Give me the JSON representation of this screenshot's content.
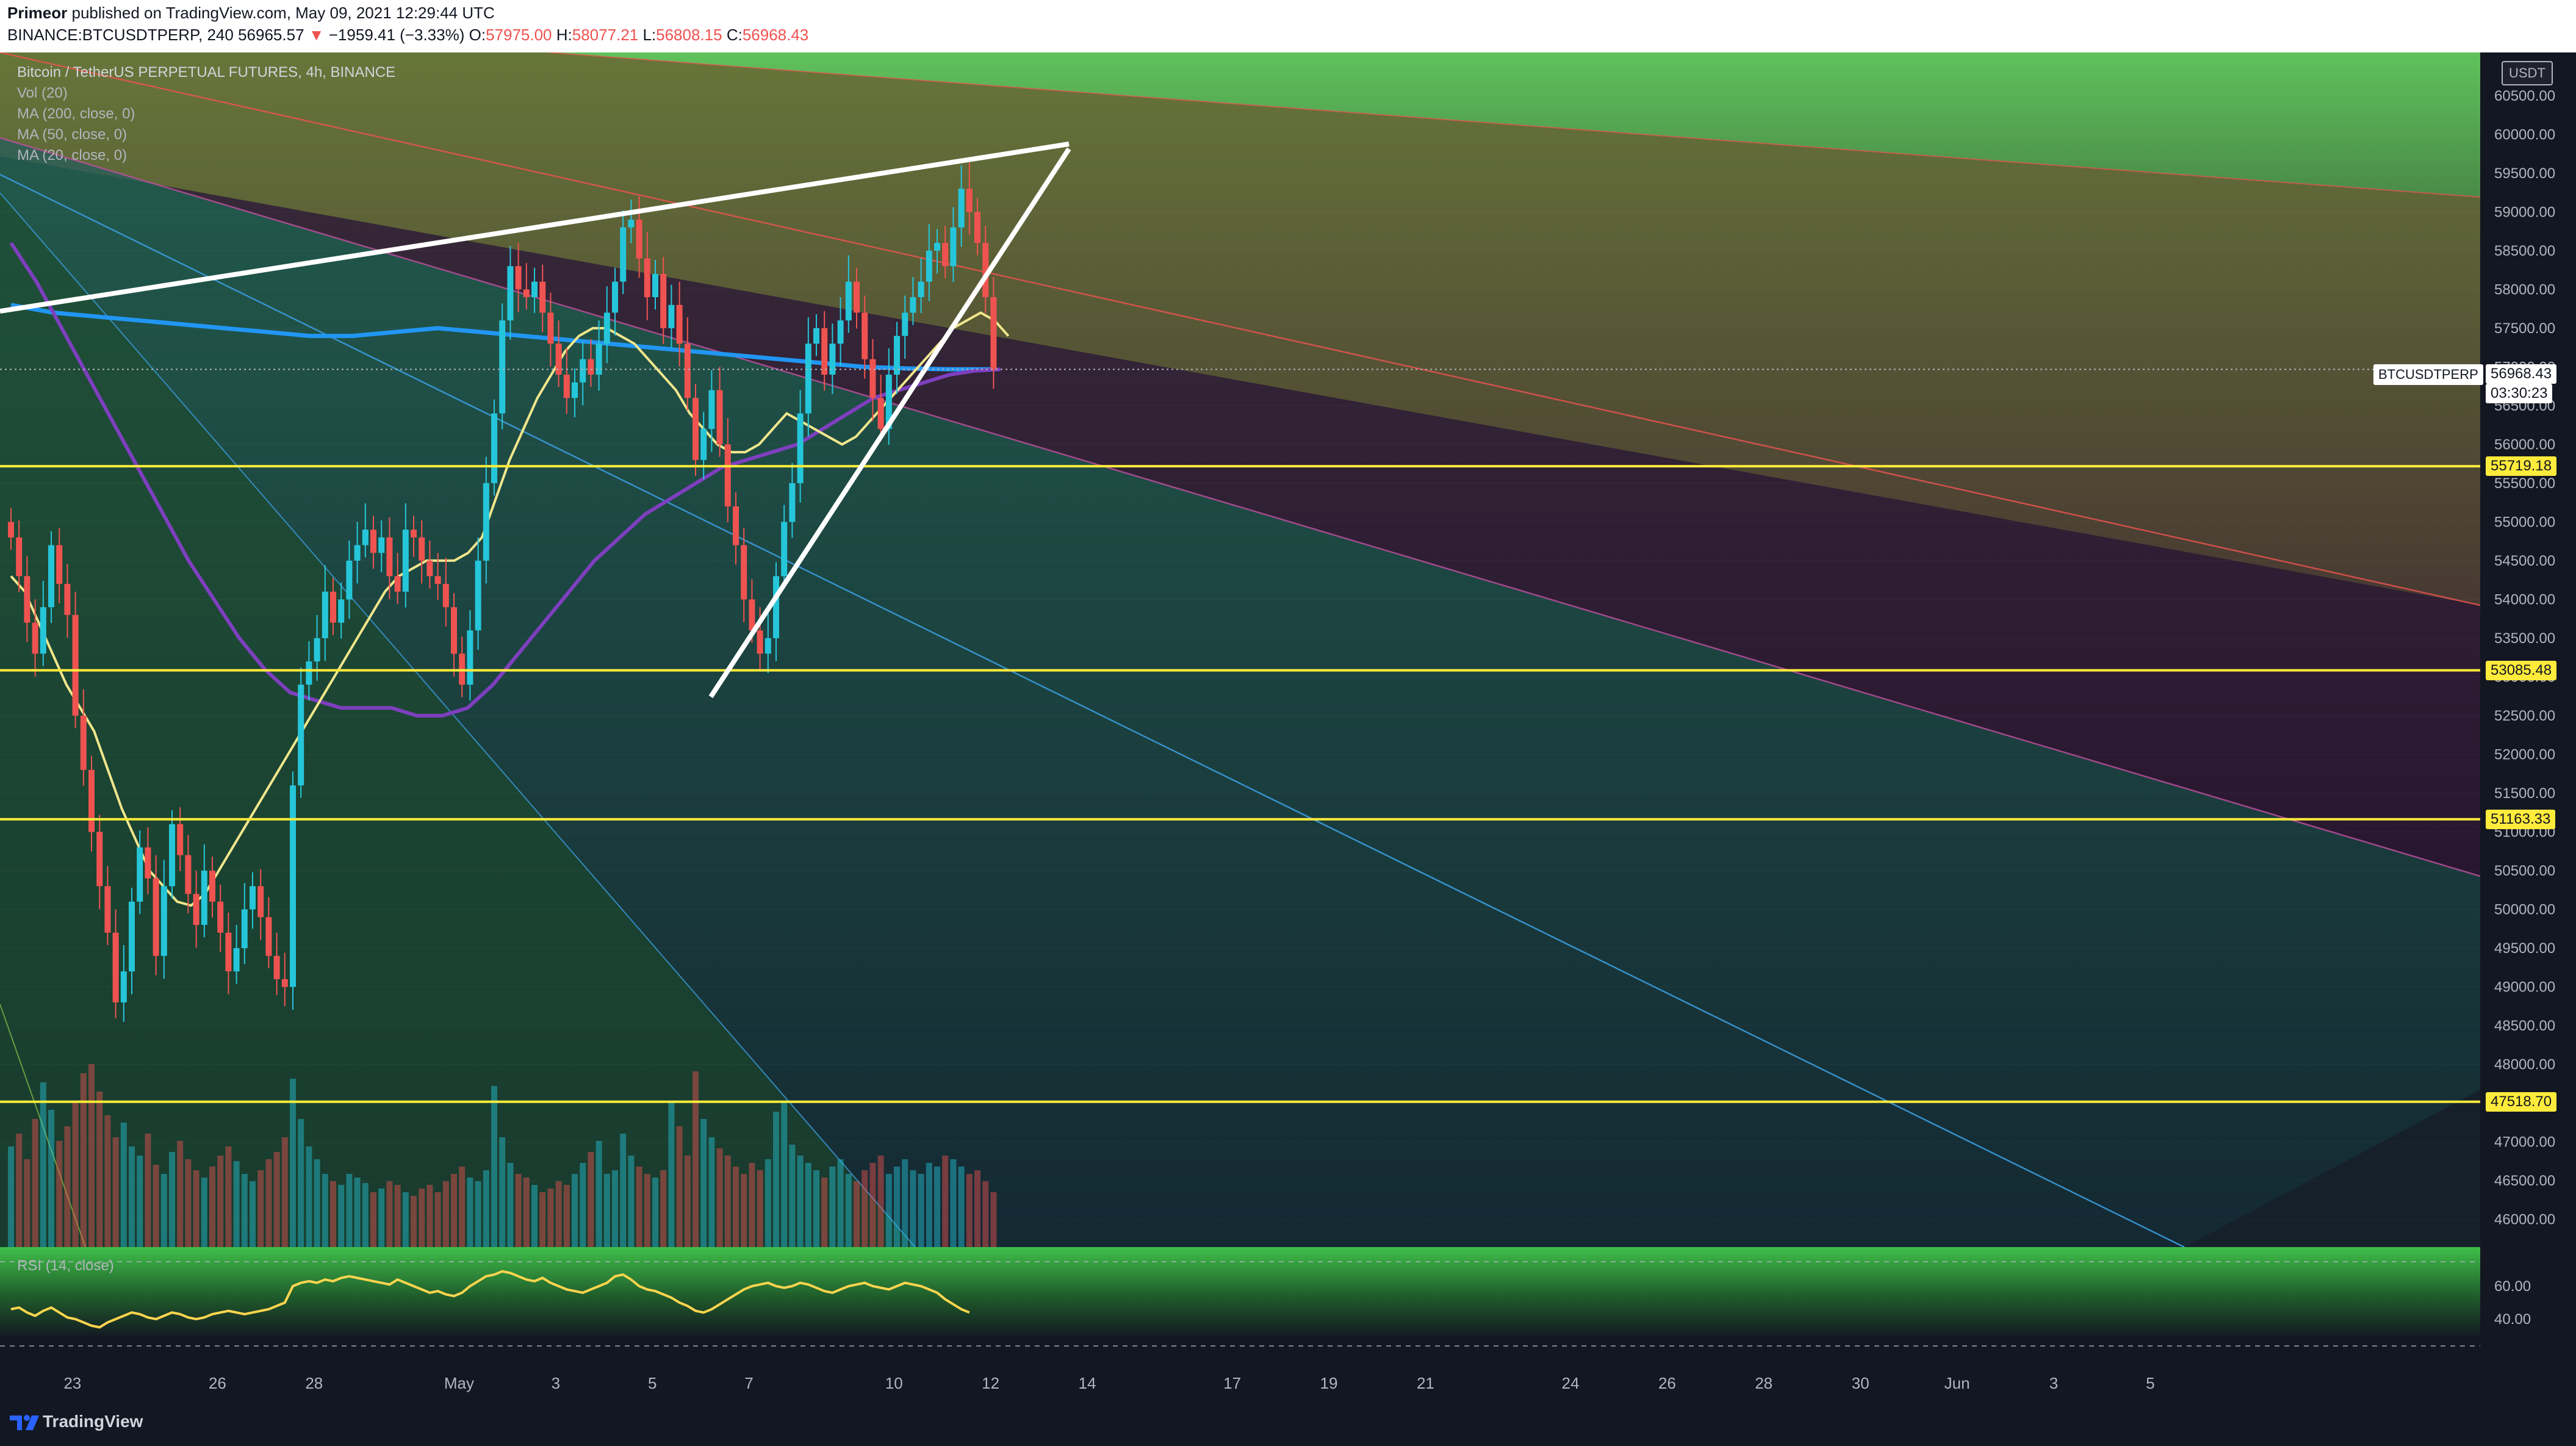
{
  "header": {
    "author": "Primeor",
    "published_text": "published on TradingView.com, May 09, 2021 12:29:44 UTC",
    "symbol_interval": "BINANCE:BTCUSDTPERP, 240",
    "last_price": "56965.57",
    "change_arrow": "▼",
    "change": "−1959.41 (−3.33%)",
    "o_label": "O:",
    "o_value": "57975.00",
    "h_label": "H:",
    "h_value": "58077.21",
    "l_label": "L:",
    "l_value": "56808.15",
    "c_label": "C:",
    "c_value": "56968.43"
  },
  "legend": {
    "title": "Bitcoin / TetherUS PERPETUAL FUTURES, 4h, BINANCE",
    "indicators": [
      "Vol (20)",
      "MA (200, close, 0)",
      "MA (50, close, 0)",
      "MA (20, close, 0)"
    ]
  },
  "rsi_label": "RSI (14, close)",
  "currency_button": "USDT",
  "symbol_tag": "BTCUSDTPERP",
  "current_price_badge": "56968.43",
  "countdown": "03:30:23",
  "footer": {
    "brand": "TradingView"
  },
  "colors": {
    "candle_up": "#26c6da",
    "candle_down": "#ef5350",
    "ma20": "#f0e68c",
    "ma50": "#7e3fbf",
    "ma200": "#2196f3",
    "support_line": "#ffeb3b",
    "wedge": "#ffffff"
  },
  "chart_data": {
    "type": "candlestick",
    "interval": "4h",
    "price_axis": {
      "ticks": [
        "60500.00",
        "60000.00",
        "59500.00",
        "59000.00",
        "58500.00",
        "58000.00",
        "57500.00",
        "57000.00",
        "56500.00",
        "56000.00",
        "55500.00",
        "55000.00",
        "54500.00",
        "54000.00",
        "53500.00",
        "53000.00",
        "52500.00",
        "52000.00",
        "51500.00",
        "51000.00",
        "50500.00",
        "50000.00",
        "49500.00",
        "49000.00",
        "48500.00",
        "48000.00",
        "47500.00",
        "47000.00",
        "46500.00",
        "46000.00"
      ],
      "range": [
        45800,
        60900
      ]
    },
    "time_axis": {
      "labels": [
        "23",
        "26",
        "28",
        "May",
        "3",
        "5",
        "7",
        "10",
        "12",
        "14",
        "17",
        "19",
        "21",
        "24",
        "26",
        "28",
        "30",
        "Jun",
        "3",
        "5"
      ],
      "index": [
        4,
        22,
        34,
        52,
        64,
        76,
        88,
        106,
        118,
        130,
        148,
        160,
        172,
        190,
        202,
        214,
        226,
        238,
        250,
        262
      ]
    },
    "rsi_axis": {
      "ticks": [
        "60.00",
        "40.00"
      ],
      "range": [
        20,
        80
      ]
    },
    "support_levels": [
      {
        "value": 55719.18,
        "label": "55719.18"
      },
      {
        "value": 53085.48,
        "label": "53085.48"
      },
      {
        "value": 51163.33,
        "label": "51163.33"
      },
      {
        "value": 47518.7,
        "label": "47518.70"
      }
    ],
    "ohlc_close": [
      54800,
      54300,
      53700,
      53300,
      53900,
      54700,
      54200,
      53800,
      52500,
      51800,
      51000,
      50300,
      49700,
      48800,
      49200,
      50100,
      50800,
      50400,
      49400,
      50300,
      51100,
      50700,
      50200,
      49800,
      50500,
      50100,
      49700,
      49200,
      49500,
      50000,
      50300,
      49900,
      49400,
      49100,
      49000,
      51600,
      52900,
      53200,
      53500,
      54100,
      53700,
      54000,
      54500,
      54700,
      54900,
      54600,
      54800,
      54300,
      54100,
      54900,
      54800,
      54500,
      54300,
      54200,
      53900,
      53300,
      52900,
      53600,
      54500,
      55500,
      56400,
      57600,
      58300,
      58000,
      57900,
      58100,
      57700,
      57300,
      56900,
      56600,
      56800,
      57100,
      56900,
      57300,
      57700,
      58100,
      58800,
      58900,
      58400,
      57900,
      58200,
      57500,
      57800,
      57300,
      56600,
      55800,
      56200,
      56700,
      56000,
      55200,
      54700,
      54000,
      53600,
      53300,
      53500,
      54300,
      55000,
      55500,
      56400,
      57300,
      57500,
      56900,
      57300,
      57600,
      58100,
      57700,
      57100,
      56600,
      56200,
      56900,
      57400,
      57700,
      57900,
      58100,
      58500,
      58600,
      58300,
      58800,
      59300,
      59000,
      58600,
      57900,
      56968
    ],
    "ma20": [
      54300,
      54100,
      53700,
      53300,
      52900,
      52600,
      52300,
      51800,
      51300,
      50900,
      50500,
      50300,
      50100,
      50050,
      50200,
      50500,
      50800,
      51100,
      51400,
      51700,
      52000,
      52300,
      52600,
      52900,
      53200,
      53500,
      53800,
      54100,
      54300,
      54400,
      54500,
      54500,
      54500,
      54600,
      54800,
      55300,
      55800,
      56200,
      56600,
      56900,
      57200,
      57400,
      57500,
      57500,
      57400,
      57300,
      57100,
      56900,
      56700,
      56400,
      56200,
      56000,
      55900,
      55900,
      56000,
      56200,
      56400,
      56300,
      56200,
      56100,
      56000,
      56100,
      56300,
      56500,
      56700,
      56900,
      57100,
      57300,
      57500,
      57600,
      57700,
      57600,
      57400
    ],
    "ma50": [
      58600,
      58100,
      57500,
      56900,
      56300,
      55700,
      55100,
      54500,
      54000,
      53500,
      53100,
      52800,
      52700,
      52600,
      52600,
      52600,
      52500,
      52500,
      52600,
      52900,
      53300,
      53700,
      54100,
      54500,
      54800,
      55100,
      55300,
      55500,
      55700,
      55800,
      55900,
      56000,
      56200,
      56400,
      56600,
      56700,
      56800,
      56900,
      56950,
      56968
    ],
    "ma200": [
      57800,
      57700,
      57650,
      57600,
      57550,
      57500,
      57450,
      57400,
      57400,
      57450,
      57500,
      57450,
      57400,
      57350,
      57300,
      57250,
      57200,
      57150,
      57100,
      57050,
      57000,
      56980,
      56970,
      56968
    ],
    "volume_relative": [
      0.55,
      0.62,
      0.48,
      0.7,
      0.9,
      0.75,
      0.58,
      0.66,
      0.8,
      0.95,
      1.0,
      0.85,
      0.72,
      0.6,
      0.68,
      0.55,
      0.5,
      0.62,
      0.45,
      0.4,
      0.52,
      0.58,
      0.48,
      0.42,
      0.38,
      0.44,
      0.5,
      0.55,
      0.47,
      0.4,
      0.36,
      0.42,
      0.48,
      0.52,
      0.6,
      0.92,
      0.7,
      0.55,
      0.48,
      0.4,
      0.36,
      0.34,
      0.4,
      0.38,
      0.35,
      0.3,
      0.32,
      0.36,
      0.34,
      0.3,
      0.28,
      0.32,
      0.34,
      0.3,
      0.36,
      0.4,
      0.44,
      0.38,
      0.36,
      0.42,
      0.88,
      0.6,
      0.46,
      0.4,
      0.38,
      0.34,
      0.3,
      0.32,
      0.36,
      0.34,
      0.4,
      0.46,
      0.52,
      0.58,
      0.4,
      0.42,
      0.62,
      0.5,
      0.44,
      0.4,
      0.38,
      0.42,
      0.8,
      0.66,
      0.5,
      0.96,
      0.7,
      0.6,
      0.54,
      0.5,
      0.44,
      0.4,
      0.46,
      0.42,
      0.48,
      0.74,
      0.8,
      0.56,
      0.5,
      0.46,
      0.42,
      0.38,
      0.44,
      0.48,
      0.4,
      0.36,
      0.42,
      0.46,
      0.5,
      0.4,
      0.44,
      0.48,
      0.42,
      0.4,
      0.46,
      0.44,
      0.5,
      0.48,
      0.44,
      0.4,
      0.42,
      0.36,
      0.3
    ],
    "rsi": [
      46,
      47,
      44,
      42,
      45,
      47,
      44,
      41,
      40,
      38,
      36,
      35,
      38,
      40,
      42,
      44,
      43,
      41,
      40,
      42,
      44,
      43,
      41,
      40,
      41,
      43,
      44,
      45,
      44,
      43,
      44,
      45,
      46,
      48,
      50,
      60,
      62,
      63,
      62,
      64,
      63,
      65,
      66,
      65,
      64,
      63,
      62,
      61,
      64,
      62,
      60,
      58,
      56,
      57,
      55,
      54,
      56,
      60,
      63,
      66,
      67,
      69,
      68,
      66,
      64,
      63,
      65,
      62,
      60,
      58,
      57,
      56,
      58,
      60,
      62,
      66,
      67,
      64,
      60,
      58,
      57,
      55,
      53,
      50,
      48,
      45,
      44,
      46,
      49,
      52,
      55,
      58,
      60,
      61,
      62,
      60,
      59,
      60,
      62,
      61,
      59,
      57,
      56,
      58,
      60,
      61,
      62,
      60,
      59,
      58,
      60,
      62,
      61,
      60,
      58,
      56,
      52,
      49,
      46,
      44
    ]
  }
}
